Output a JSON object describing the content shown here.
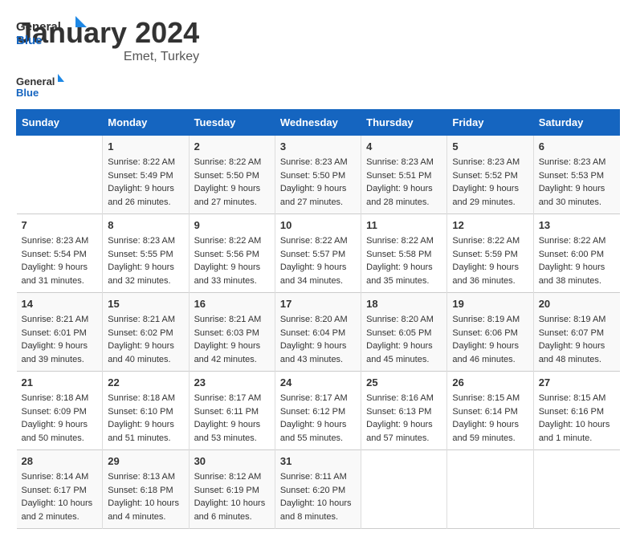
{
  "logo": {
    "text_general": "General",
    "text_blue": "Blue"
  },
  "title": "January 2024",
  "subtitle": "Emet, Turkey",
  "header_color": "#1565c0",
  "days_of_week": [
    "Sunday",
    "Monday",
    "Tuesday",
    "Wednesday",
    "Thursday",
    "Friday",
    "Saturday"
  ],
  "weeks": [
    [
      {
        "day": "",
        "info": ""
      },
      {
        "day": "1",
        "info": "Sunrise: 8:22 AM\nSunset: 5:49 PM\nDaylight: 9 hours\nand 26 minutes."
      },
      {
        "day": "2",
        "info": "Sunrise: 8:22 AM\nSunset: 5:50 PM\nDaylight: 9 hours\nand 27 minutes."
      },
      {
        "day": "3",
        "info": "Sunrise: 8:23 AM\nSunset: 5:50 PM\nDaylight: 9 hours\nand 27 minutes."
      },
      {
        "day": "4",
        "info": "Sunrise: 8:23 AM\nSunset: 5:51 PM\nDaylight: 9 hours\nand 28 minutes."
      },
      {
        "day": "5",
        "info": "Sunrise: 8:23 AM\nSunset: 5:52 PM\nDaylight: 9 hours\nand 29 minutes."
      },
      {
        "day": "6",
        "info": "Sunrise: 8:23 AM\nSunset: 5:53 PM\nDaylight: 9 hours\nand 30 minutes."
      }
    ],
    [
      {
        "day": "7",
        "info": "Sunrise: 8:23 AM\nSunset: 5:54 PM\nDaylight: 9 hours\nand 31 minutes."
      },
      {
        "day": "8",
        "info": "Sunrise: 8:23 AM\nSunset: 5:55 PM\nDaylight: 9 hours\nand 32 minutes."
      },
      {
        "day": "9",
        "info": "Sunrise: 8:22 AM\nSunset: 5:56 PM\nDaylight: 9 hours\nand 33 minutes."
      },
      {
        "day": "10",
        "info": "Sunrise: 8:22 AM\nSunset: 5:57 PM\nDaylight: 9 hours\nand 34 minutes."
      },
      {
        "day": "11",
        "info": "Sunrise: 8:22 AM\nSunset: 5:58 PM\nDaylight: 9 hours\nand 35 minutes."
      },
      {
        "day": "12",
        "info": "Sunrise: 8:22 AM\nSunset: 5:59 PM\nDaylight: 9 hours\nand 36 minutes."
      },
      {
        "day": "13",
        "info": "Sunrise: 8:22 AM\nSunset: 6:00 PM\nDaylight: 9 hours\nand 38 minutes."
      }
    ],
    [
      {
        "day": "14",
        "info": "Sunrise: 8:21 AM\nSunset: 6:01 PM\nDaylight: 9 hours\nand 39 minutes."
      },
      {
        "day": "15",
        "info": "Sunrise: 8:21 AM\nSunset: 6:02 PM\nDaylight: 9 hours\nand 40 minutes."
      },
      {
        "day": "16",
        "info": "Sunrise: 8:21 AM\nSunset: 6:03 PM\nDaylight: 9 hours\nand 42 minutes."
      },
      {
        "day": "17",
        "info": "Sunrise: 8:20 AM\nSunset: 6:04 PM\nDaylight: 9 hours\nand 43 minutes."
      },
      {
        "day": "18",
        "info": "Sunrise: 8:20 AM\nSunset: 6:05 PM\nDaylight: 9 hours\nand 45 minutes."
      },
      {
        "day": "19",
        "info": "Sunrise: 8:19 AM\nSunset: 6:06 PM\nDaylight: 9 hours\nand 46 minutes."
      },
      {
        "day": "20",
        "info": "Sunrise: 8:19 AM\nSunset: 6:07 PM\nDaylight: 9 hours\nand 48 minutes."
      }
    ],
    [
      {
        "day": "21",
        "info": "Sunrise: 8:18 AM\nSunset: 6:09 PM\nDaylight: 9 hours\nand 50 minutes."
      },
      {
        "day": "22",
        "info": "Sunrise: 8:18 AM\nSunset: 6:10 PM\nDaylight: 9 hours\nand 51 minutes."
      },
      {
        "day": "23",
        "info": "Sunrise: 8:17 AM\nSunset: 6:11 PM\nDaylight: 9 hours\nand 53 minutes."
      },
      {
        "day": "24",
        "info": "Sunrise: 8:17 AM\nSunset: 6:12 PM\nDaylight: 9 hours\nand 55 minutes."
      },
      {
        "day": "25",
        "info": "Sunrise: 8:16 AM\nSunset: 6:13 PM\nDaylight: 9 hours\nand 57 minutes."
      },
      {
        "day": "26",
        "info": "Sunrise: 8:15 AM\nSunset: 6:14 PM\nDaylight: 9 hours\nand 59 minutes."
      },
      {
        "day": "27",
        "info": "Sunrise: 8:15 AM\nSunset: 6:16 PM\nDaylight: 10 hours\nand 1 minute."
      }
    ],
    [
      {
        "day": "28",
        "info": "Sunrise: 8:14 AM\nSunset: 6:17 PM\nDaylight: 10 hours\nand 2 minutes."
      },
      {
        "day": "29",
        "info": "Sunrise: 8:13 AM\nSunset: 6:18 PM\nDaylight: 10 hours\nand 4 minutes."
      },
      {
        "day": "30",
        "info": "Sunrise: 8:12 AM\nSunset: 6:19 PM\nDaylight: 10 hours\nand 6 minutes."
      },
      {
        "day": "31",
        "info": "Sunrise: 8:11 AM\nSunset: 6:20 PM\nDaylight: 10 hours\nand 8 minutes."
      },
      {
        "day": "",
        "info": ""
      },
      {
        "day": "",
        "info": ""
      },
      {
        "day": "",
        "info": ""
      }
    ]
  ]
}
